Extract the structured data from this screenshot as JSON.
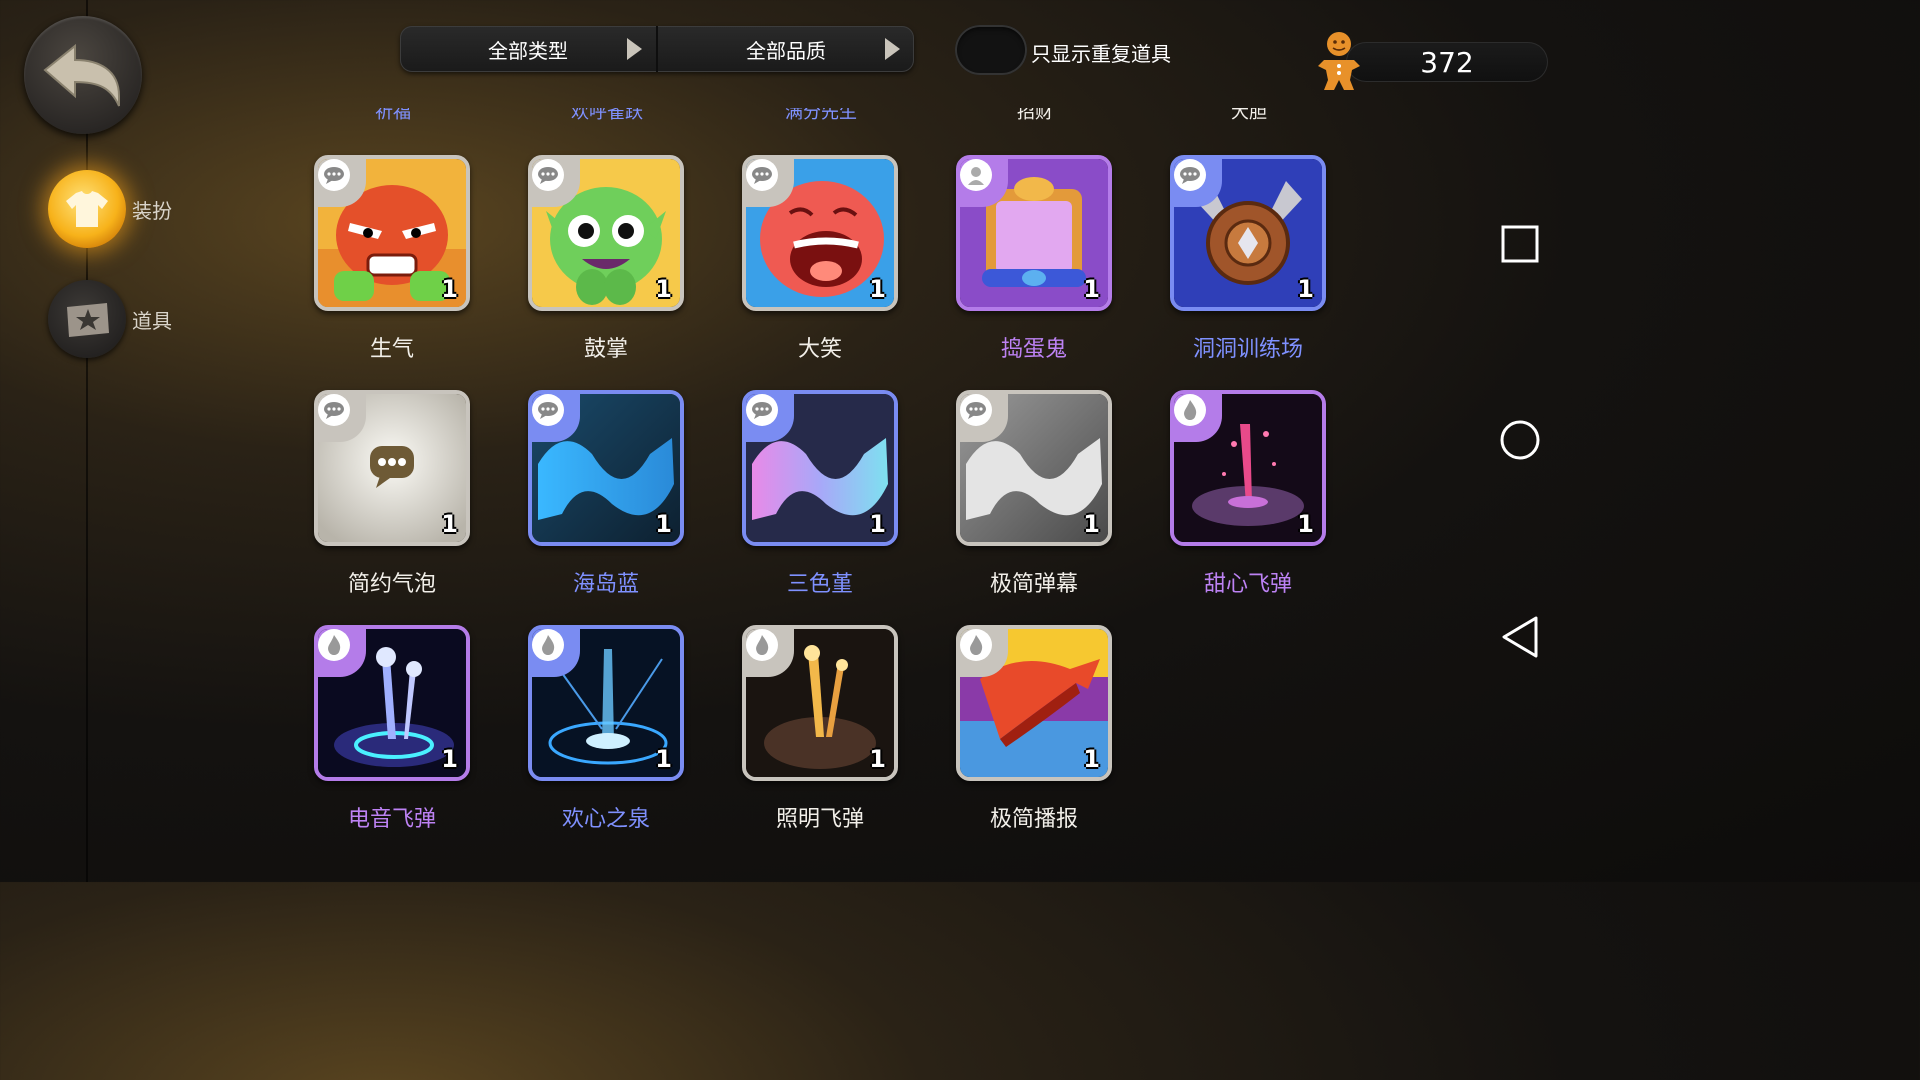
{
  "header": {
    "type_filter_label": "全部类型",
    "quality_filter_label": "全部品质",
    "duplicate_toggle_label": "只显示重复道具",
    "currency_value": "372"
  },
  "sidebar": {
    "items": [
      {
        "label": "装扮",
        "icon": "costume-shirt-icon",
        "selected": true
      },
      {
        "label": "道具",
        "icon": "props-icon",
        "selected": false
      }
    ]
  },
  "items": [
    {
      "name": "生气",
      "count": "1",
      "quality": "white",
      "category": "chat-bubble-icon"
    },
    {
      "name": "鼓掌",
      "count": "1",
      "quality": "white",
      "category": "chat-bubble-icon"
    },
    {
      "name": "大笑",
      "count": "1",
      "quality": "white",
      "category": "chat-bubble-icon"
    },
    {
      "name": "捣蛋鬼",
      "count": "1",
      "quality": "purple",
      "category": "avatar-icon"
    },
    {
      "name": "洞洞训练场",
      "count": "1",
      "quality": "blue",
      "category": "chat-bubble-icon"
    },
    {
      "name": "简约气泡",
      "count": "1",
      "quality": "white",
      "category": "chat-bubble-icon"
    },
    {
      "name": "海岛蓝",
      "count": "1",
      "quality": "blue",
      "category": "chat-bubble-icon"
    },
    {
      "name": "三色堇",
      "count": "1",
      "quality": "blue",
      "category": "chat-bubble-icon"
    },
    {
      "name": "极简弹幕",
      "count": "1",
      "quality": "white",
      "category": "chat-bubble-icon"
    },
    {
      "name": "甜心飞弹",
      "count": "1",
      "quality": "purple",
      "category": "flame-icon"
    },
    {
      "name": "电音飞弹",
      "count": "1",
      "quality": "purple",
      "category": "flame-icon"
    },
    {
      "name": "欢心之泉",
      "count": "1",
      "quality": "blue",
      "category": "flame-icon"
    },
    {
      "name": "照明飞弹",
      "count": "1",
      "quality": "white",
      "category": "flame-icon"
    },
    {
      "name": "极简播报",
      "count": "1",
      "quality": "white",
      "category": "flame-icon"
    }
  ],
  "previous_row_labels": [
    "祈福",
    "欢呼雀跃",
    "满分先生",
    "招财",
    "大胆"
  ],
  "colors": {
    "quality_white": "#c8c4bd",
    "quality_blue": "#7a8cf2",
    "quality_purple": "#b47ce9"
  },
  "system_nav": [
    "square-recents-icon",
    "circle-home-icon",
    "triangle-back-icon"
  ]
}
